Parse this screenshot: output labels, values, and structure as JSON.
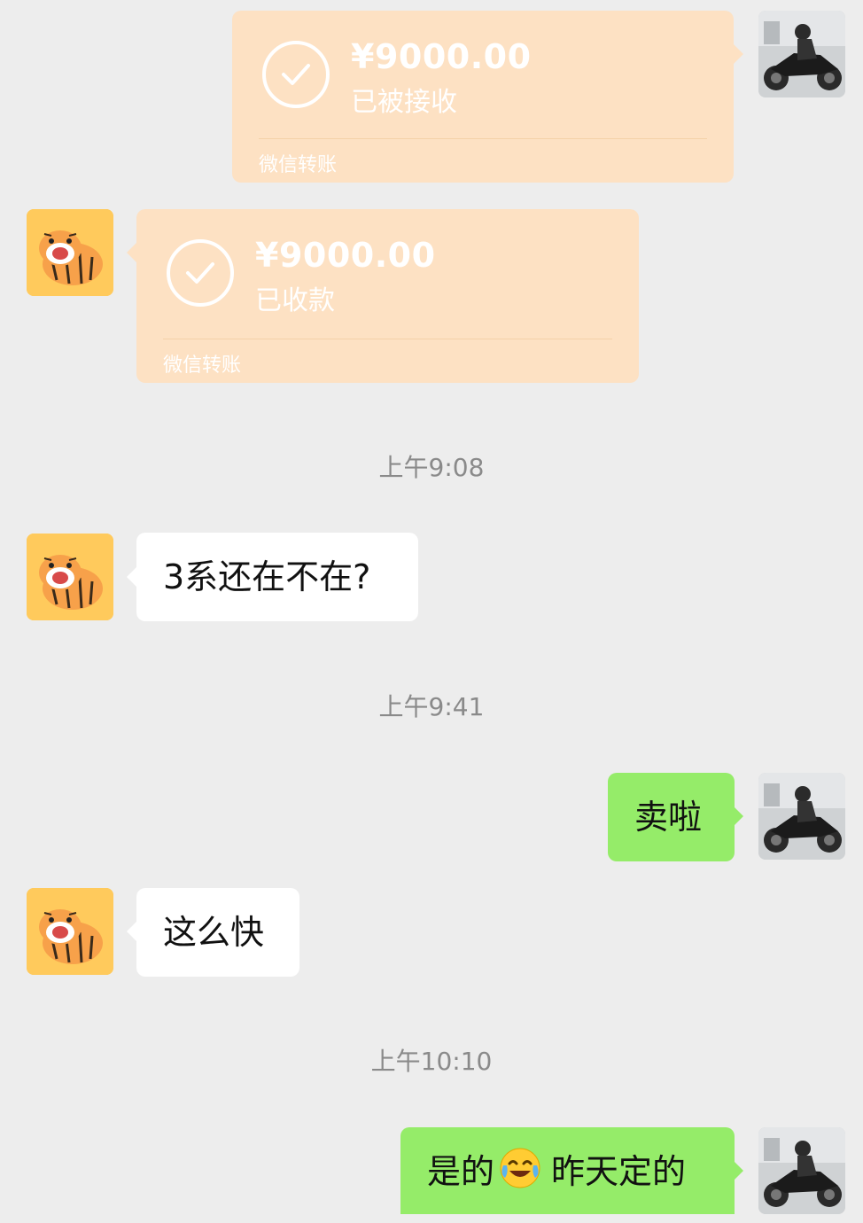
{
  "messages": [
    {
      "type": "transfer",
      "side": "right",
      "amount": "¥9000.00",
      "status": "已被接收",
      "footer": "微信转账"
    },
    {
      "type": "transfer",
      "side": "left",
      "amount": "¥9000.00",
      "status": "已收款",
      "footer": "微信转账"
    },
    {
      "type": "time",
      "text": "上午9:08"
    },
    {
      "type": "text",
      "side": "left",
      "text": "3系还在不在?"
    },
    {
      "type": "time",
      "text": "上午9:41"
    },
    {
      "type": "text",
      "side": "right",
      "text": "卖啦"
    },
    {
      "type": "text",
      "side": "left",
      "text": "这么快"
    },
    {
      "type": "time",
      "text": "上午10:10"
    },
    {
      "type": "text",
      "side": "right",
      "text_before": "是的",
      "emoji": "crying-laughing-face",
      "text_after": "昨天定的"
    }
  ],
  "colors": {
    "background": "#ededed",
    "transfer_card": "#fde1c3",
    "bubble_self": "#95ec69",
    "bubble_other": "#ffffff"
  },
  "avatars": {
    "self": "motorcycle-rider-avatar",
    "other": "tiger-avatar"
  }
}
